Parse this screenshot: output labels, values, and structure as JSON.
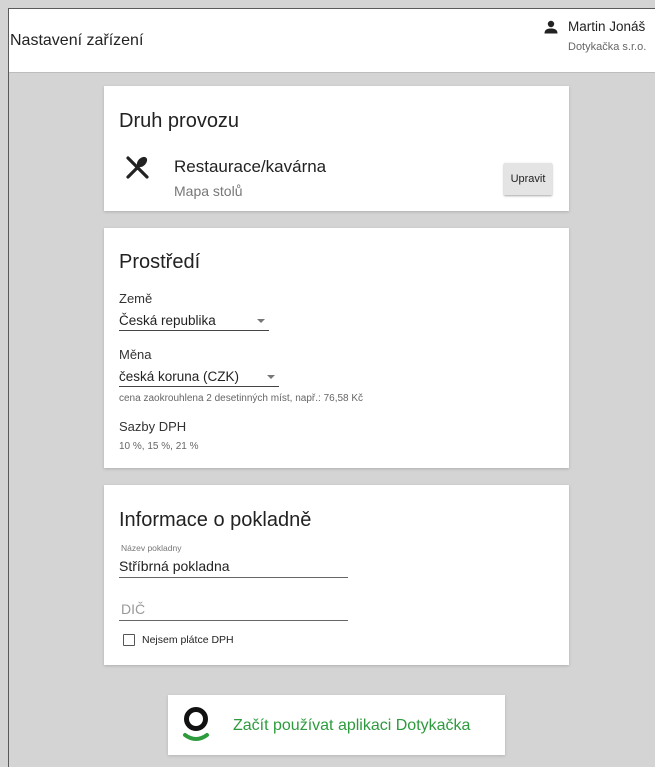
{
  "header": {
    "title": "Nastavení zařízení",
    "user_name": "Martin Jonáš",
    "company": "Dotykačka s.r.o."
  },
  "operation": {
    "title": "Druh provozu",
    "type": "Restaurace/kavárna",
    "subtype": "Mapa stolů",
    "edit_label": "Upravit"
  },
  "environment": {
    "title": "Prostředí",
    "country_label": "Země",
    "country_value": "Česká republika",
    "currency_label": "Měna",
    "currency_value": "česká koruna (CZK)",
    "currency_hint": "cena zaokrouhlena 2 desetinných míst, např.: 76,58 Kč",
    "vat_label": "Sazby DPH",
    "vat_rates": "10 %, 15 %, 21 %"
  },
  "register": {
    "title": "Informace o pokladně",
    "name_label": "Název pokladny",
    "name_value": "Stříbrná pokladna",
    "dic_placeholder": "DIČ",
    "not_vat_payer_label": "Nejsem plátce DPH",
    "not_vat_payer_checked": false
  },
  "start_button": {
    "label": "Začít používat aplikaci Dotykačka"
  },
  "colors": {
    "accent_green": "#2d9b3d",
    "background": "#d4d4d4"
  }
}
